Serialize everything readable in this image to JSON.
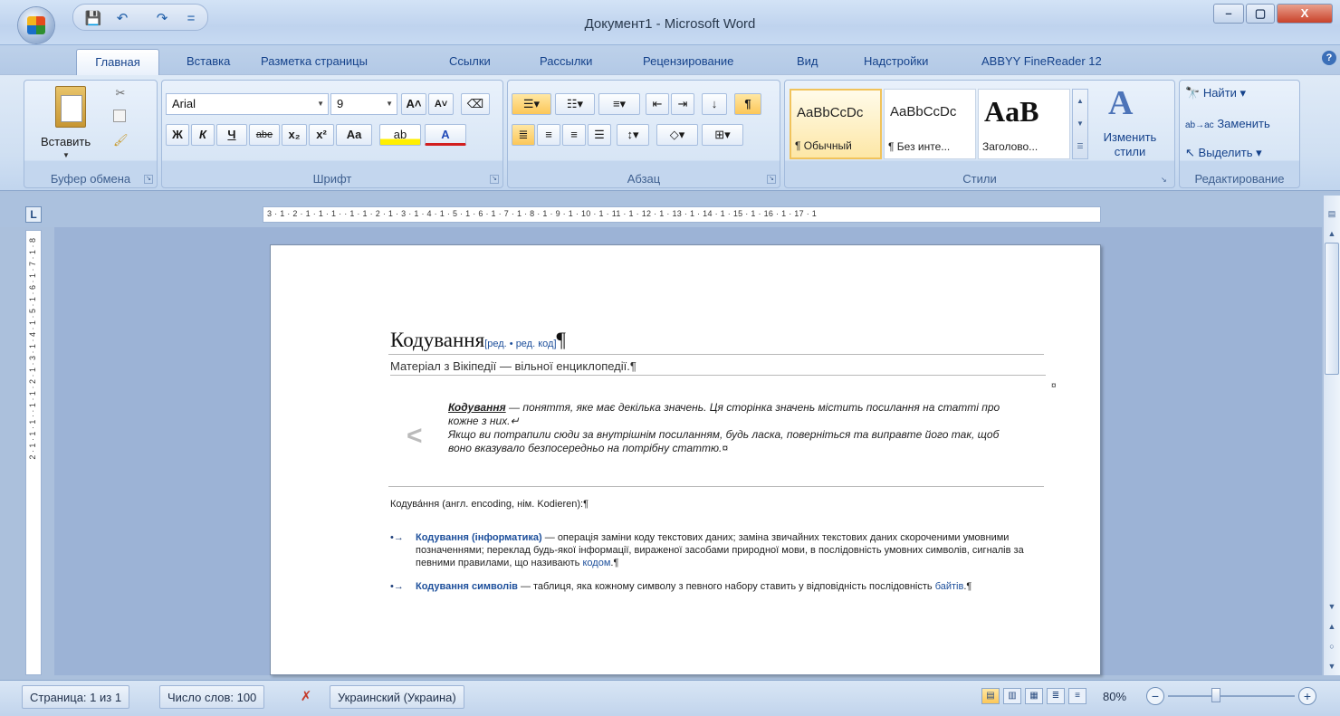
{
  "window": {
    "title": "Документ1 - Microsoft Word",
    "minimize": "–",
    "maximize": "▢",
    "close": "X"
  },
  "qat": {
    "save": "💾",
    "undo": "↶",
    "redo": "↷",
    "more": "="
  },
  "tabs": [
    "Главная",
    "Вставка",
    "Разметка страницы",
    "Ссылки",
    "Рассылки",
    "Рецензирование",
    "Вид",
    "Надстройки",
    "ABBYY FineReader 12"
  ],
  "help": "?",
  "ribbon": {
    "clipboard": {
      "paste_label": "Вставить",
      "group_label": "Буфер обмена"
    },
    "font": {
      "family": "Arial",
      "size": "9",
      "grow": "A˄",
      "shrink": "A˅",
      "bold": "Ж",
      "italic": "К",
      "underline": "Ч",
      "strike": "abe",
      "sub": "x₂",
      "sup": "x²",
      "case": "Aa",
      "highlight": "ab",
      "color": "A",
      "group_label": "Шрифт"
    },
    "paragraph": {
      "group_label": "Абзац",
      "pilcrow": "¶"
    },
    "styles": {
      "items": [
        {
          "preview": "AaBbCcDc",
          "name": "¶ Обычный"
        },
        {
          "preview": "AaBbCcDc",
          "name": "¶ Без инте..."
        },
        {
          "preview": "AaB",
          "name": "Заголово..."
        }
      ],
      "change_label": "Изменить стили",
      "group_label": "Стили"
    },
    "editing": {
      "find": "Найти",
      "replace": "Заменить",
      "select": "Выделить",
      "group_label": "Редактирование"
    }
  },
  "ruler": {
    "corner": "L",
    "horizontal": "3 · 1 · 2 · 1 · 1 · 1 ·   · 1 · 1 · 2 · 1 · 3 · 1 · 4 · 1 · 5 · 1 · 6 · 1 · 7 · 1 · 8 · 1 · 9 · 1 · 10 · 1 · 11 · 1 · 12 · 1 · 13 · 1 · 14 · 1 · 15 · 1 · 16 · 1 · 17 · 1",
    "vertical": "2 · 1 · 1 · 1 ·   · 1 · 1 · 2 · 1 · 3 · 1 · 4 · 1 · 5 · 1 · 6 · 1 · 7 · 1 · 8"
  },
  "document": {
    "heading": "Кодування",
    "heading_edit": "[ред. • ред. код]",
    "heading_mark": "¶",
    "subtitle": "Матеріал з Вікіпедії — вільної енциклопедії.¶",
    "cell_mark": "¤",
    "disambig_icon": "<",
    "disambig_bold": "Кодування",
    "disambig_text1": " — поняття, яке має декілька значень. Ця сторінка значень містить посилання на статті про кожне з них.↵",
    "disambig_text2": "Якщо ви потрапили сюди за внутрішнім посиланням, будь ласка, поверніться та виправте його так, щоб воно вказувало безпосередньо на потрібну статтю.¤",
    "intro": "Кодува́ння (англ. encoding, нім. Kodieren):¶",
    "items": [
      {
        "bullet": "•→",
        "link": "Кодування (інформатика)",
        "text": " — операція заміни коду текстових даних; заміна звичайних текстових даних скороченими умовними позначеннями; переклад будь-якої інформації, вираженої засобами природної мови, в послідовність умовних символів, сигналів за певними правилами, що називають ",
        "link2": "кодом",
        "end": ".¶"
      },
      {
        "bullet": "•→",
        "link": "Кодування символів",
        "text": " — таблиця, яка кожному символу з певного набору ставить у відповідність послідовність ",
        "link2": "байтів",
        "end": ".¶"
      }
    ]
  },
  "status": {
    "page": "Страница: 1 из 1",
    "words": "Число слов: 100",
    "language": "Украинский (Украина)",
    "zoom": "80%",
    "zoom_minus": "−",
    "zoom_plus": "+"
  },
  "colors": {
    "accent": "#15428b",
    "link": "#1d4f9b"
  }
}
